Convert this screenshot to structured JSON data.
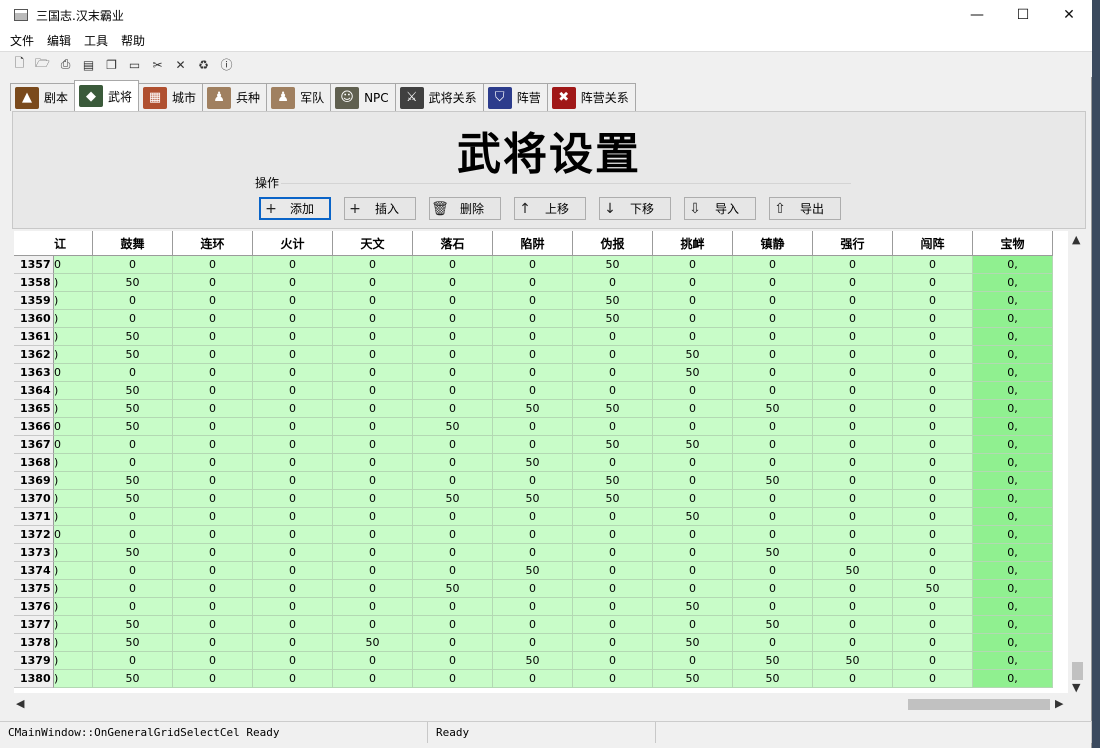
{
  "window": {
    "title": "三国志.汉末霸业",
    "minimize": "—",
    "maximize": "☐",
    "close": "✕"
  },
  "menu": [
    "文件",
    "编辑",
    "工具",
    "帮助"
  ],
  "toolbar": [
    "new-file-icon",
    "open-folder-icon",
    "print-icon",
    "archive-icon",
    "copy-icon",
    "folder-icon",
    "cut-icon",
    "tools-icon",
    "recycle-icon",
    "help-icon"
  ],
  "tabs": [
    {
      "label": "剧本",
      "icon": "scenario-icon",
      "color": "#7a4a1c"
    },
    {
      "label": "武将",
      "icon": "general-icon",
      "color": "#3a5a3a",
      "active": true
    },
    {
      "label": "城市",
      "icon": "city-icon",
      "color": "#b05030"
    },
    {
      "label": "兵种",
      "icon": "troop-type-icon",
      "color": "#a08060"
    },
    {
      "label": "军队",
      "icon": "army-icon",
      "color": "#a08060"
    },
    {
      "label": "NPC",
      "icon": "npc-icon",
      "color": "#606050"
    },
    {
      "label": "武将关系",
      "icon": "relation-icon",
      "color": "#404040"
    },
    {
      "label": "阵营",
      "icon": "faction-icon",
      "color": "#2c3c8c"
    },
    {
      "label": "阵营关系",
      "icon": "faction-relation-icon",
      "color": "#a01818"
    }
  ],
  "panel": {
    "heading": "武将设置",
    "group_label": "操作",
    "buttons": [
      {
        "label": "添加",
        "icon": "+"
      },
      {
        "label": "插入",
        "icon": "+"
      },
      {
        "label": "删除",
        "icon": "🗑"
      },
      {
        "label": "上移",
        "icon": "↑"
      },
      {
        "label": "下移",
        "icon": "↓"
      },
      {
        "label": "导入",
        "icon": "⇩"
      },
      {
        "label": "导出",
        "icon": "⇧"
      }
    ]
  },
  "grid": {
    "columns": [
      "讧",
      "鼓舞",
      "连环",
      "火计",
      "天文",
      "落石",
      "陷阱",
      "伪报",
      "挑衅",
      "镇静",
      "强行",
      "闯阵",
      "宝物"
    ],
    "rows": [
      {
        "id": "1357",
        "cells": [
          "0",
          "0",
          "0",
          "0",
          "0",
          "0",
          "0",
          "50",
          "0",
          "0",
          "0",
          "0",
          "0,"
        ]
      },
      {
        "id": "1358",
        "cells": [
          ")",
          "50",
          "0",
          "0",
          "0",
          "0",
          "0",
          "0",
          "0",
          "0",
          "0",
          "0",
          "0,"
        ]
      },
      {
        "id": "1359",
        "cells": [
          ")",
          "0",
          "0",
          "0",
          "0",
          "0",
          "0",
          "50",
          "0",
          "0",
          "0",
          "0",
          "0,"
        ]
      },
      {
        "id": "1360",
        "cells": [
          ")",
          "0",
          "0",
          "0",
          "0",
          "0",
          "0",
          "50",
          "0",
          "0",
          "0",
          "0",
          "0,"
        ]
      },
      {
        "id": "1361",
        "cells": [
          ")",
          "50",
          "0",
          "0",
          "0",
          "0",
          "0",
          "0",
          "0",
          "0",
          "0",
          "0",
          "0,"
        ]
      },
      {
        "id": "1362",
        "cells": [
          ")",
          "50",
          "0",
          "0",
          "0",
          "0",
          "0",
          "0",
          "50",
          "0",
          "0",
          "0",
          "0,"
        ]
      },
      {
        "id": "1363",
        "cells": [
          "0",
          "0",
          "0",
          "0",
          "0",
          "0",
          "0",
          "0",
          "50",
          "0",
          "0",
          "0",
          "0,"
        ]
      },
      {
        "id": "1364",
        "cells": [
          ")",
          "50",
          "0",
          "0",
          "0",
          "0",
          "0",
          "0",
          "0",
          "0",
          "0",
          "0",
          "0,"
        ]
      },
      {
        "id": "1365",
        "cells": [
          ")",
          "50",
          "0",
          "0",
          "0",
          "0",
          "50",
          "50",
          "0",
          "50",
          "0",
          "0",
          "0,"
        ]
      },
      {
        "id": "1366",
        "cells": [
          "0",
          "50",
          "0",
          "0",
          "0",
          "50",
          "0",
          "0",
          "0",
          "0",
          "0",
          "0",
          "0,"
        ]
      },
      {
        "id": "1367",
        "cells": [
          "0",
          "0",
          "0",
          "0",
          "0",
          "0",
          "0",
          "50",
          "50",
          "0",
          "0",
          "0",
          "0,"
        ]
      },
      {
        "id": "1368",
        "cells": [
          ")",
          "0",
          "0",
          "0",
          "0",
          "0",
          "50",
          "0",
          "0",
          "0",
          "0",
          "0",
          "0,"
        ]
      },
      {
        "id": "1369",
        "cells": [
          ")",
          "50",
          "0",
          "0",
          "0",
          "0",
          "0",
          "50",
          "0",
          "50",
          "0",
          "0",
          "0,"
        ]
      },
      {
        "id": "1370",
        "cells": [
          ")",
          "50",
          "0",
          "0",
          "0",
          "50",
          "50",
          "50",
          "0",
          "0",
          "0",
          "0",
          "0,"
        ]
      },
      {
        "id": "1371",
        "cells": [
          ")",
          "0",
          "0",
          "0",
          "0",
          "0",
          "0",
          "0",
          "50",
          "0",
          "0",
          "0",
          "0,"
        ]
      },
      {
        "id": "1372",
        "cells": [
          "0",
          "0",
          "0",
          "0",
          "0",
          "0",
          "0",
          "0",
          "0",
          "0",
          "0",
          "0",
          "0,"
        ]
      },
      {
        "id": "1373",
        "cells": [
          ")",
          "50",
          "0",
          "0",
          "0",
          "0",
          "0",
          "0",
          "0",
          "50",
          "0",
          "0",
          "0,"
        ]
      },
      {
        "id": "1374",
        "cells": [
          ")",
          "0",
          "0",
          "0",
          "0",
          "0",
          "50",
          "0",
          "0",
          "0",
          "50",
          "0",
          "0,"
        ]
      },
      {
        "id": "1375",
        "cells": [
          ")",
          "0",
          "0",
          "0",
          "0",
          "50",
          "0",
          "0",
          "0",
          "0",
          "0",
          "50",
          "0,"
        ]
      },
      {
        "id": "1376",
        "cells": [
          ")",
          "0",
          "0",
          "0",
          "0",
          "0",
          "0",
          "0",
          "50",
          "0",
          "0",
          "0",
          "0,"
        ]
      },
      {
        "id": "1377",
        "cells": [
          ")",
          "50",
          "0",
          "0",
          "0",
          "0",
          "0",
          "0",
          "0",
          "50",
          "0",
          "0",
          "0,"
        ]
      },
      {
        "id": "1378",
        "cells": [
          ")",
          "50",
          "0",
          "0",
          "50",
          "0",
          "0",
          "0",
          "50",
          "0",
          "0",
          "0",
          "0,"
        ]
      },
      {
        "id": "1379",
        "cells": [
          ")",
          "0",
          "0",
          "0",
          "0",
          "0",
          "50",
          "0",
          "0",
          "50",
          "50",
          "0",
          "0,"
        ]
      },
      {
        "id": "1380",
        "cells": [
          ")",
          "50",
          "0",
          "0",
          "0",
          "0",
          "0",
          "0",
          "50",
          "50",
          "0",
          "0",
          "0,"
        ]
      }
    ]
  },
  "status": {
    "left": "CMainWindow::OnGeneralGridSelectCel Ready",
    "middle": "Ready"
  },
  "colors": {
    "cell": "#c8fcc8",
    "highlight_column": "#90f090",
    "focus": "#0a64c8"
  }
}
